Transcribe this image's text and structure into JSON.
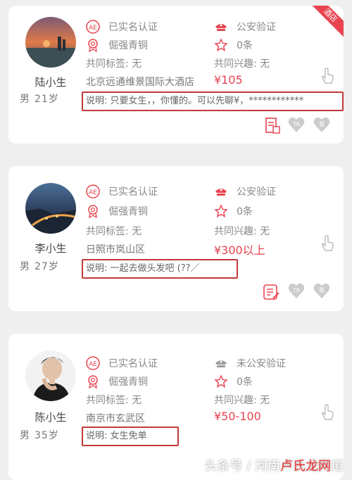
{
  "cards": [
    {
      "name": "陆小生",
      "gender": "男",
      "age": "21岁",
      "verify_id": "已实名认证",
      "verify_police": "公安验证",
      "level": "倔强青铜",
      "count": "0条",
      "tags": "共同标签: 无",
      "interests": "共同兴趣: 无",
      "location": "北京远通维景国际大酒店",
      "price": "¥105",
      "note": "说明: 只要女生，，你懂的。可以先聊¥，************",
      "ribbon": "酒店",
      "actions": [
        "doc-icon",
        "TA",
        "我"
      ]
    },
    {
      "name": "李小生",
      "gender": "男",
      "age": "27岁",
      "verify_id": "已实名认证",
      "verify_police": "公安验证",
      "level": "倔强青铜",
      "count": "0条",
      "tags": "共同标签: 无",
      "interests": "共同兴趣: 无",
      "location": "日照市岚山区",
      "price": "¥300以上",
      "note": "说明: 一起去做头发吧 (??／",
      "actions": [
        "edit-icon",
        "TA",
        "我"
      ]
    },
    {
      "name": "陈小生",
      "gender": "男",
      "age": "35岁",
      "verify_id": "已实名认证",
      "verify_police": "未公安验证",
      "level": "倔强青铜",
      "count": "0条",
      "tags": "共同标签: 无",
      "interests": "共同兴趣: 无",
      "location": "南京市玄武区",
      "price": "¥50-100",
      "note": "说明: 女生免单"
    }
  ],
  "watermark": {
    "prefix": "头条号 / 河南",
    "brand": "卢氏龙网",
    "suffix": "道"
  },
  "colors": {
    "accent": "#e8434f",
    "note_border": "#c23a3a",
    "badge_gray": "#cccccc"
  }
}
